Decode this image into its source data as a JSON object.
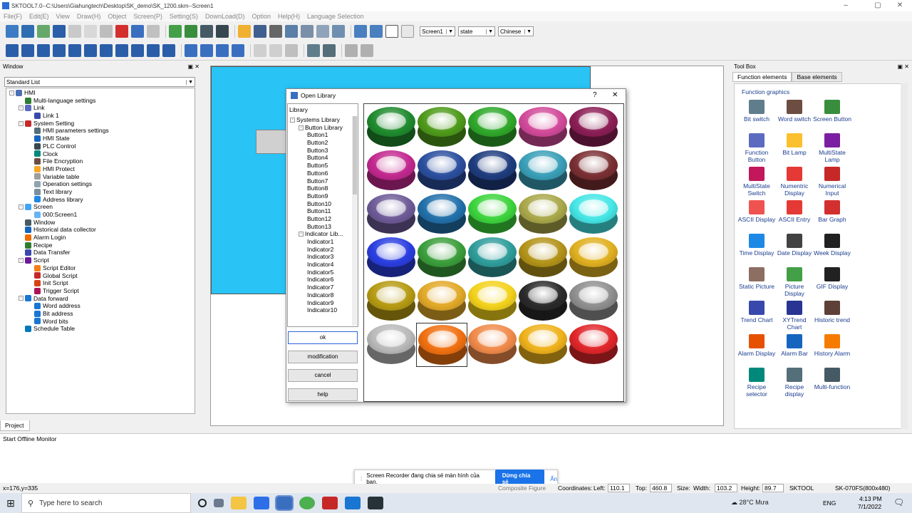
{
  "app": {
    "title": "SKTOOL7.0--C:\\Users\\Giahungtech\\Desktop\\SK_demo\\SK_1200.skm--Screen1",
    "window_controls": [
      "–",
      "▢",
      "✕"
    ]
  },
  "menu": [
    "File(F)",
    "Edit(E)",
    "View",
    "Draw(H)",
    "Object",
    "Screen(P)",
    "Setting(S)",
    "DownLoad(D)",
    "Option",
    "Help(H)",
    "Language Selection"
  ],
  "toolbar": {
    "screen_select": "Screen1",
    "state_select": "state",
    "language_select": "Chinese"
  },
  "left_panel": {
    "title": "Window",
    "list_select": "Standard List",
    "tab": "Project",
    "tree": [
      {
        "label": "HMI",
        "level": 0,
        "exp": "-",
        "color": "#4a6fb5"
      },
      {
        "label": "Multi-language settings",
        "level": 1,
        "color": "#2e7d32"
      },
      {
        "label": "Link",
        "level": 1,
        "exp": "-",
        "color": "#5c6bc0"
      },
      {
        "label": "Link 1",
        "level": 2,
        "color": "#3949ab"
      },
      {
        "label": "System Setting",
        "level": 1,
        "exp": "-",
        "color": "#c62828"
      },
      {
        "label": "HMI parameters settings",
        "level": 2,
        "color": "#546e7a"
      },
      {
        "label": "HMI State",
        "level": 2,
        "color": "#1565c0"
      },
      {
        "label": "PLC Control",
        "level": 2,
        "color": "#37474f"
      },
      {
        "label": "Clock",
        "level": 2,
        "color": "#00897b"
      },
      {
        "label": "File Encryption",
        "level": 2,
        "color": "#6d4c41"
      },
      {
        "label": "HMI Protect",
        "level": 2,
        "color": "#f9a825"
      },
      {
        "label": "Variable table",
        "level": 2,
        "color": "#9e9e9e"
      },
      {
        "label": "Operation settings",
        "level": 2,
        "color": "#90a4ae"
      },
      {
        "label": "Text library",
        "level": 2,
        "color": "#78909c"
      },
      {
        "label": "Address library",
        "level": 2,
        "color": "#1e88e5"
      },
      {
        "label": "Screen",
        "level": 1,
        "exp": "-",
        "color": "#42a5f5"
      },
      {
        "label": "000:Screen1",
        "level": 2,
        "color": "#64b5f6"
      },
      {
        "label": "Window",
        "level": 1,
        "color": "#455a64"
      },
      {
        "label": "Historical data collector",
        "level": 1,
        "color": "#1565c0"
      },
      {
        "label": "Alarm Login",
        "level": 1,
        "color": "#ef6c00"
      },
      {
        "label": "Recipe",
        "level": 1,
        "color": "#2e7d32"
      },
      {
        "label": "Data Transfer",
        "level": 1,
        "color": "#3949ab"
      },
      {
        "label": "Script",
        "level": 1,
        "exp": "-",
        "color": "#6a1b9a"
      },
      {
        "label": "Script Editor",
        "level": 2,
        "color": "#f57f17"
      },
      {
        "label": "Global Script",
        "level": 2,
        "color": "#c62828"
      },
      {
        "label": "Init Script",
        "level": 2,
        "color": "#d84315"
      },
      {
        "label": "Trigger Script",
        "level": 2,
        "color": "#ad1457"
      },
      {
        "label": "Data forward",
        "level": 1,
        "exp": "-",
        "color": "#1976d2"
      },
      {
        "label": "Word address",
        "level": 2,
        "color": "#1976d2"
      },
      {
        "label": "Bit address",
        "level": 2,
        "color": "#1976d2"
      },
      {
        "label": "Word bits",
        "level": 2,
        "color": "#1976d2"
      },
      {
        "label": "Schedule Table",
        "level": 1,
        "color": "#0277bd"
      }
    ]
  },
  "bottom_panel": {
    "title": "Start Offline Monitor"
  },
  "dialog": {
    "title": "Open Library",
    "help_glyph": "?",
    "close_glyph": "✕",
    "library_header": "Library",
    "tree": [
      {
        "label": "Systems Library",
        "level": 0,
        "exp": "-"
      },
      {
        "label": "Button Library",
        "level": 1,
        "exp": "-"
      },
      {
        "label": "Button1",
        "level": 2
      },
      {
        "label": "Button2",
        "level": 2
      },
      {
        "label": "Button3",
        "level": 2
      },
      {
        "label": "Button4",
        "level": 2
      },
      {
        "label": "Button5",
        "level": 2
      },
      {
        "label": "Button6",
        "level": 2
      },
      {
        "label": "Button7",
        "level": 2
      },
      {
        "label": "Button8",
        "level": 2
      },
      {
        "label": "Button9",
        "level": 2
      },
      {
        "label": "Button10",
        "level": 2
      },
      {
        "label": "Button11",
        "level": 2
      },
      {
        "label": "Button12",
        "level": 2
      },
      {
        "label": "Button13",
        "level": 2
      },
      {
        "label": "Indicator Lib...",
        "level": 1,
        "exp": "-"
      },
      {
        "label": "Indicator1",
        "level": 2
      },
      {
        "label": "Indicator2",
        "level": 2
      },
      {
        "label": "Indicator3",
        "level": 2
      },
      {
        "label": "Indicator4",
        "level": 2
      },
      {
        "label": "Indicator5",
        "level": 2
      },
      {
        "label": "Indicator6",
        "level": 2
      },
      {
        "label": "Indicator7",
        "level": 2
      },
      {
        "label": "Indicator8",
        "level": 2
      },
      {
        "label": "Indicator9",
        "level": 2
      },
      {
        "label": "Indicator10",
        "level": 2
      }
    ],
    "buttons": {
      "ok": "ok",
      "modification": "modification",
      "cancel": "cancel",
      "help": "help"
    },
    "swatches": [
      "#1f8a2e",
      "#4e9a1a",
      "#2fa82a",
      "#d24a9a",
      "#8b1e55",
      "#c2288f",
      "#2b4f9e",
      "#1e3c7e",
      "#3a9fb8",
      "#7a2f33",
      "#6d5a96",
      "#2270aa",
      "#3cd43c",
      "#a9a84a",
      "#45e6e6",
      "#2a3ee0",
      "#3b9e3b",
      "#2f9d9b",
      "#b39319",
      "#e0b020",
      "#b59a12",
      "#e2a928",
      "#f3d21c",
      "#2a2a2a",
      "#8f8f8f",
      "#b9b9b9",
      "#f07010",
      "#f08a4a",
      "#efb21c",
      "#e0262a"
    ],
    "selected_index": 26
  },
  "toolbox": {
    "title": "Tool Box",
    "tabs": [
      "Function elements",
      "Base elements"
    ],
    "section": "Function graphics",
    "items": [
      {
        "label": "Bit switch",
        "color": "#607d8b"
      },
      {
        "label": "Word switch",
        "color": "#6d4c41"
      },
      {
        "label": "Screen Button",
        "color": "#388e3c"
      },
      {
        "label": "Function Button",
        "color": "#5c6bc0"
      },
      {
        "label": "Bit Lamp",
        "color": "#fbc02d"
      },
      {
        "label": "MultiState Lamp",
        "color": "#7b1fa2"
      },
      {
        "label": "MultiState Switch",
        "color": "#c2185b"
      },
      {
        "label": "Numentric Display",
        "color": "#e53935"
      },
      {
        "label": "Numerical Input",
        "color": "#c62828"
      },
      {
        "label": "ASCII Display",
        "color": "#ef5350"
      },
      {
        "label": "ASCII Entry",
        "color": "#e53935"
      },
      {
        "label": "Bar Graph",
        "color": "#d32f2f"
      },
      {
        "label": "Time Display",
        "color": "#1e88e5"
      },
      {
        "label": "Date Display",
        "color": "#424242"
      },
      {
        "label": "Week Display",
        "color": "#212121"
      },
      {
        "label": "Static Picture",
        "color": "#8d6e63"
      },
      {
        "label": "Picture Display",
        "color": "#43a047"
      },
      {
        "label": "GIF Display",
        "color": "#212121"
      },
      {
        "label": "Trend Chart",
        "color": "#3949ab"
      },
      {
        "label": "XYTrend Chart",
        "color": "#283593"
      },
      {
        "label": "Historic trend",
        "color": "#5d4037"
      },
      {
        "label": "Alarm Display",
        "color": "#e65100"
      },
      {
        "label": "Alarm Bar",
        "color": "#1565c0"
      },
      {
        "label": "History Alarm",
        "color": "#f57c00"
      },
      {
        "label": "Recipe selector",
        "color": "#00897b"
      },
      {
        "label": "Recipe display",
        "color": "#546e7a"
      },
      {
        "label": "Multi-function",
        "color": "#455a64"
      }
    ]
  },
  "status": {
    "coords": "x=176,y=335",
    "coordinates_label": "Coordinates:",
    "left_label": "Left:",
    "left": "110.1",
    "top_label": "Top:",
    "top": "460.8",
    "size_label": "Size:",
    "width_label": "Width:",
    "width": "103.2",
    "height_label": "Height:",
    "height": "89.7",
    "brand": "SKTOOL",
    "model": "SK-070FS(800x480)",
    "composite": "Composite Figure"
  },
  "notification": {
    "text": "Screen Recorder đang chia sẻ màn hình của bạn.",
    "share_btn": "Dừng chia sẻ",
    "hide_btn": "Ẩn"
  },
  "taskbar": {
    "search": "Type here to search",
    "weather": "28°C",
    "weather_desc": "Mưa",
    "lang": "ENG",
    "time": "4:13 PM",
    "date": "7/1/2022"
  }
}
